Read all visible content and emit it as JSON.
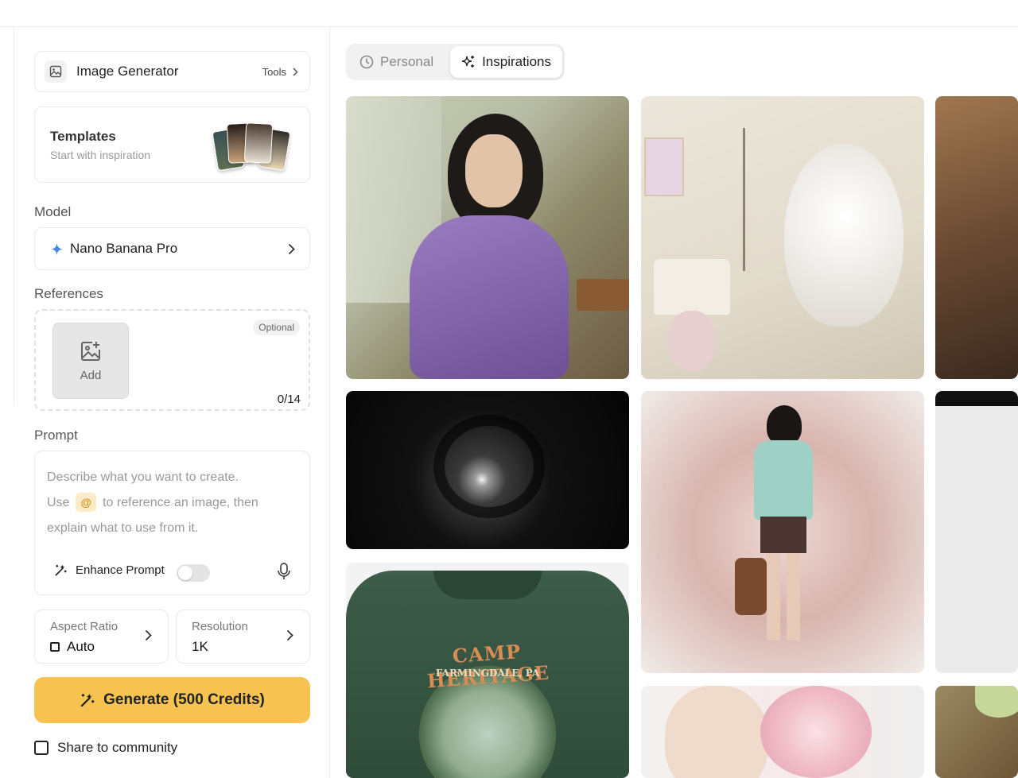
{
  "generator": {
    "title": "Image Generator",
    "tools_label": "Tools"
  },
  "templates": {
    "title": "Templates",
    "subtitle": "Start with inspiration"
  },
  "model": {
    "section_label": "Model",
    "name": "Nano Banana Pro"
  },
  "references": {
    "section_label": "References",
    "add_label": "Add",
    "optional_badge": "Optional",
    "count": "0/14"
  },
  "prompt": {
    "section_label": "Prompt",
    "placeholder_line1": "Describe what you want to create.",
    "placeholder_line2_pre": "Use",
    "at_chip": "@",
    "placeholder_line2_post": "to reference an image, then",
    "placeholder_line3": "explain what to use from it.",
    "enhance_label": "Enhance Prompt",
    "enhance_enabled": false
  },
  "aspect_ratio": {
    "label": "Aspect Ratio",
    "value": "Auto"
  },
  "resolution": {
    "label": "Resolution",
    "value": "1K"
  },
  "generate_button": "Generate (500 Credits)",
  "share": {
    "label": "Share to community",
    "checked": false
  },
  "tabs": [
    {
      "label": "Personal",
      "icon": "clock-icon",
      "active": false
    },
    {
      "label": "Inspirations",
      "icon": "sparkles-icon",
      "active": true
    }
  ],
  "tshirt": {
    "line1": "CAMP HERITAGE",
    "line2": "FARMINGDALE, PA"
  },
  "colors": {
    "accent": "#f7c350",
    "model_star": "#4a86e8",
    "chip_bg": "#fbecc7"
  }
}
